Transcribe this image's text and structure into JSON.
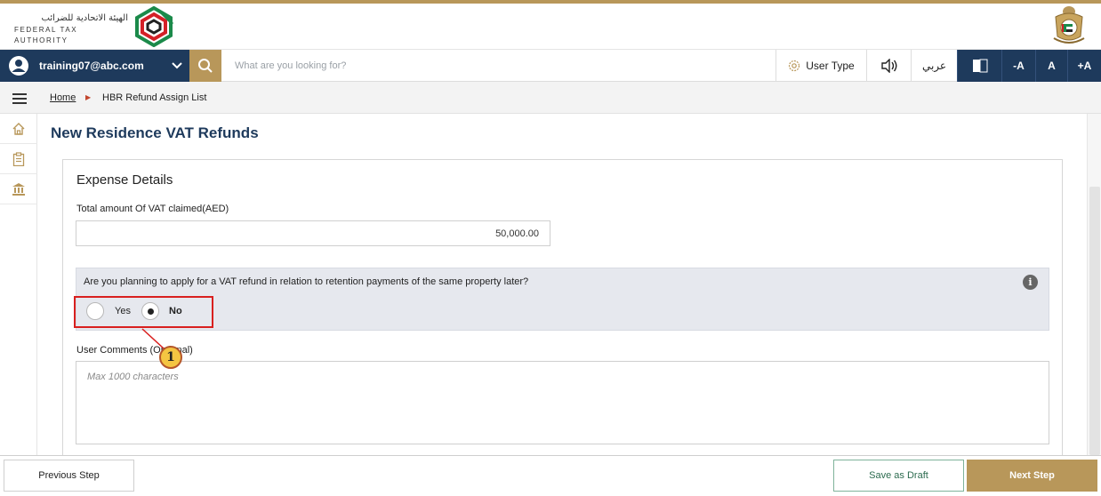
{
  "header": {
    "logo_arabic": "الهيئة الاتحادية للضرائب",
    "logo_english": "FEDERAL TAX AUTHORITY",
    "logo_icon": "fta-logo-icon",
    "emblem_icon": "uae-emblem-icon"
  },
  "toolbar": {
    "user_email": "training07@abc.com",
    "search_placeholder": "What are you looking for?",
    "user_type_label": "User Type",
    "language_label": "عربي",
    "font_decrease_label": "-A",
    "font_normal_label": "A",
    "font_increase_label": "+A"
  },
  "breadcrumb": {
    "home": "Home",
    "current": "HBR Refund Assign List"
  },
  "page": {
    "title": "New Residence VAT Refunds"
  },
  "expense": {
    "section_title": "Expense Details",
    "total_label": "Total amount Of VAT claimed(AED)",
    "total_value": "50,000.00",
    "question": "Are you planning to apply for a VAT refund in relation to retention payments of the same property later?",
    "option_yes": "Yes",
    "option_no": "No",
    "selected_option": "No",
    "comments_label": "User Comments (Optional)",
    "comments_placeholder": "Max 1000 characters"
  },
  "annotation": {
    "callout_number": "1"
  },
  "footer": {
    "previous": "Previous Step",
    "save_draft": "Save as Draft",
    "next": "Next Step"
  },
  "colors": {
    "navy": "#1e3a5c",
    "gold": "#b8975a",
    "highlight_red": "#d9201f",
    "question_bg": "#e6e8ee"
  }
}
